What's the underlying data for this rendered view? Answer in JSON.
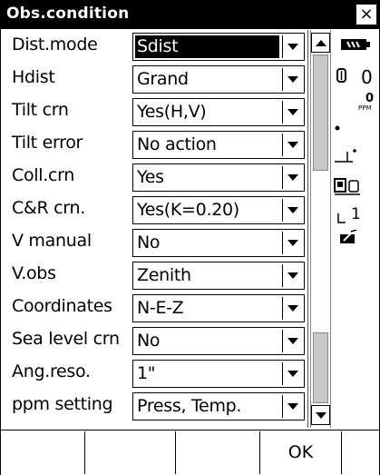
{
  "window": {
    "title": "Obs.condition",
    "close_label": "×"
  },
  "fields": [
    {
      "label": "Dist.mode",
      "value": "Sdist"
    },
    {
      "label": "Hdist",
      "value": "Grand"
    },
    {
      "label": "Tilt crn",
      "value": "Yes(H,V)"
    },
    {
      "label": "Tilt error",
      "value": "No action"
    },
    {
      "label": "Coll.crn",
      "value": "Yes"
    },
    {
      "label": "C&R crn.",
      "value": "Yes(K=0.20)"
    },
    {
      "label": "V manual",
      "value": "No"
    },
    {
      "label": "V.obs",
      "value": "Zenith"
    },
    {
      "label": "Coordinates",
      "value": "N-E-Z"
    },
    {
      "label": "Sea level crn",
      "value": "No"
    },
    {
      "label": "Ang.reso.",
      "value": "1\""
    },
    {
      "label": "ppm setting",
      "value": "Press, Temp."
    }
  ],
  "status": {
    "atmos_value": "0",
    "ppm_value": "0",
    "ppm_unit": "PPM",
    "face_value": "1"
  },
  "softkeys": [
    "",
    "",
    "",
    "OK",
    ""
  ]
}
